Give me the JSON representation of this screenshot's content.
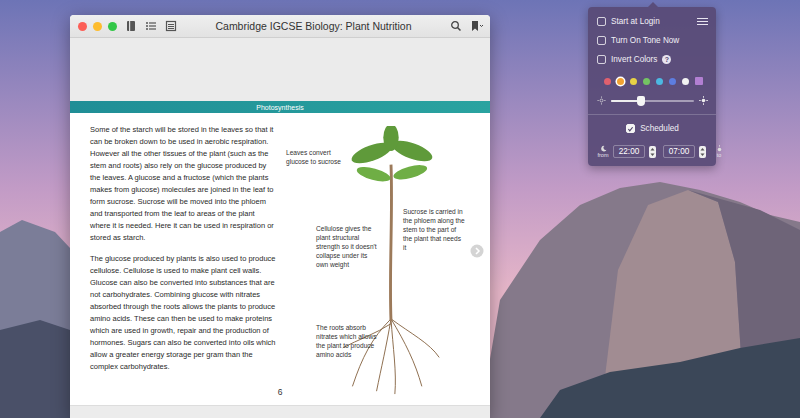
{
  "window": {
    "title": "Cambridge IGCSE Biology: Plant Nutrition"
  },
  "page": {
    "section": "Photosynthesis",
    "paragraphs": [
      "Some of the starch will be stored in the leaves so that it can be broken down to be used in aerobic respiration. However all the other tissues of the plant (such as the stem and roots) also rely on the glucose produced by the leaves. A glucose and a fructose (which the plants makes from glucose) molecules are joined in the leaf to form sucrose. Sucrose will be moved into the phloem and transported from the leaf to areas of the plant where it is needed. Here it can be used in respiration or stored as starch.",
      "The glucose produced by plants is also used to produce cellulose. Cellulose is used to make plant cell walls. Glucose can also be converted into substances that are not carbohydrates. Combining glucose with nitrates absorbed through the roots allows the plants to produce amino acids. These can then be used to make proteins which are used in growth, repair and the production of hormones. Sugars can also be converted into oils which allow a greater energy storage per gram than the complex carbohydrates."
    ],
    "figure_labels": [
      "Leaves convert glucose to sucrose",
      "Sucrose is carried in the phloem along the stem to the part of the plant that needs it",
      "Cellulose gives the plant structural strength so it doesn't collapse under its own weight",
      "The roots absorb nitrates which allows the plant to produce amino acids"
    ],
    "page_number": "6"
  },
  "popup": {
    "options": [
      {
        "label": "Start at Login",
        "checked": false,
        "kind": "menu"
      },
      {
        "label": "Turn On Tone Now",
        "checked": false,
        "kind": "plain"
      },
      {
        "label": "Invert Colors",
        "checked": false,
        "kind": "help",
        "help": "?"
      }
    ],
    "colors": [
      {
        "color": "#e0606e",
        "selected": false,
        "kind": "dot"
      },
      {
        "color": "#f0a232",
        "selected": true,
        "kind": "dot"
      },
      {
        "color": "#e8d245",
        "selected": false,
        "kind": "dot"
      },
      {
        "color": "#74c463",
        "selected": false,
        "kind": "dot"
      },
      {
        "color": "#4cb8e2",
        "selected": false,
        "kind": "dot"
      },
      {
        "color": "#5d7de0",
        "selected": false,
        "kind": "dot"
      },
      {
        "color": "#f2f2f2",
        "selected": false,
        "kind": "dot"
      },
      {
        "color": "#b27fd2",
        "selected": false,
        "kind": "square"
      }
    ],
    "brightness": {
      "level": 0.36
    },
    "schedule": {
      "label": "Scheduled",
      "checked": true,
      "from": {
        "label": "from",
        "time": "22:00"
      },
      "to": {
        "label": "to",
        "time": "07:00"
      }
    }
  }
}
